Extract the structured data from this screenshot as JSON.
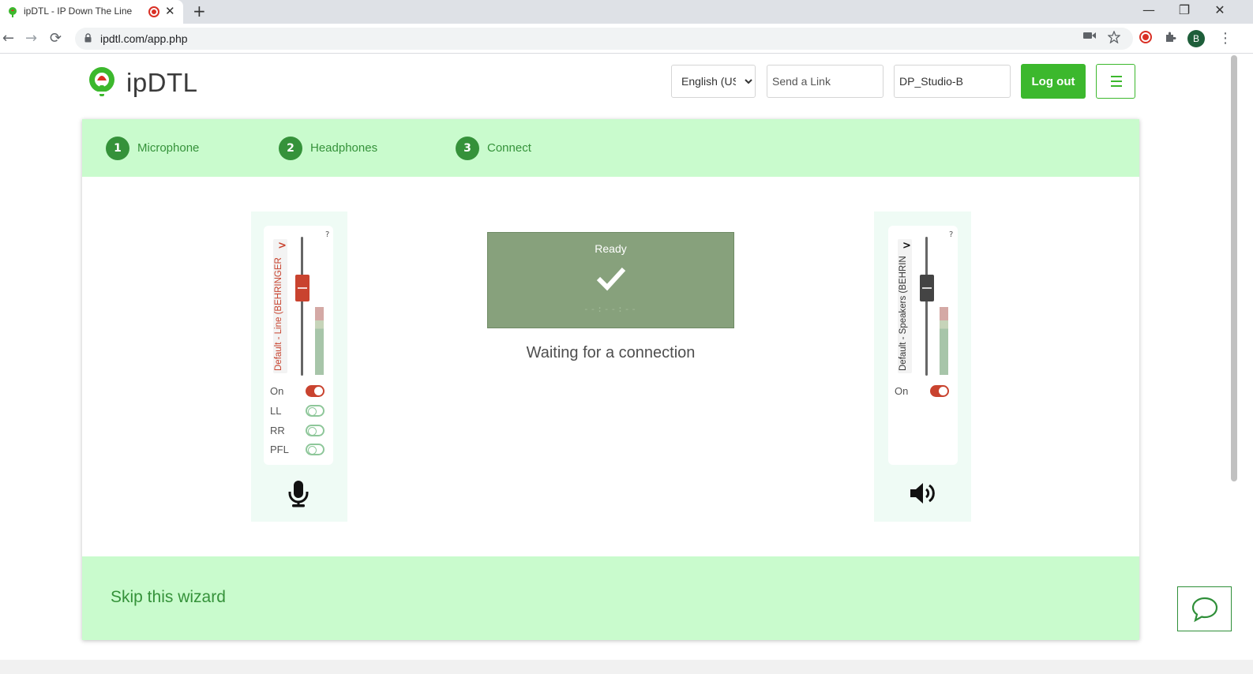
{
  "browser": {
    "tab_title": "ipDTL - IP Down The Line",
    "url": "ipdtl.com/app.php",
    "tab_close": "✕",
    "new_tab": "+",
    "back": "←",
    "forward": "→",
    "reload": "⟳",
    "minimize": "—",
    "restore": "❐",
    "close": "✕",
    "profile_initial": "B",
    "menu": "⋮"
  },
  "header": {
    "logo_text": "ipDTL",
    "language_options": [
      "English (US)"
    ],
    "language_selected": "English (US)",
    "send_link_placeholder": "Send a Link",
    "studio_name_value": "DP_Studio-B",
    "logout_label": "Log out"
  },
  "wizard": {
    "steps": [
      {
        "num": "1",
        "label": "Microphone"
      },
      {
        "num": "2",
        "label": "Headphones"
      },
      {
        "num": "3",
        "label": "Connect"
      }
    ],
    "mic_panel": {
      "device_label": "Default - Line (BEHRINGER",
      "help": "?",
      "chevron": ">",
      "fader_level": 0.75,
      "toggles": [
        {
          "label": "On",
          "state": "on"
        },
        {
          "label": "LL",
          "state": "off"
        },
        {
          "label": "RR",
          "state": "off"
        },
        {
          "label": "PFL",
          "state": "off"
        }
      ]
    },
    "status": {
      "title": "Ready",
      "timer": "--:--:--",
      "message": "Waiting for a connection"
    },
    "speaker_panel": {
      "device_label": "Default - Speakers (BEHRIN",
      "help": "?",
      "chevron": ">",
      "fader_level": 0.75,
      "toggles": [
        {
          "label": "On",
          "state": "on"
        }
      ]
    },
    "skip_label": "Skip this wizard"
  },
  "colors": {
    "accent_green": "#3cb82d",
    "step_green": "#35923a",
    "banner_bg": "#c9fbcd",
    "status_bg": "#87a17c",
    "mic_red": "#c9432f"
  }
}
